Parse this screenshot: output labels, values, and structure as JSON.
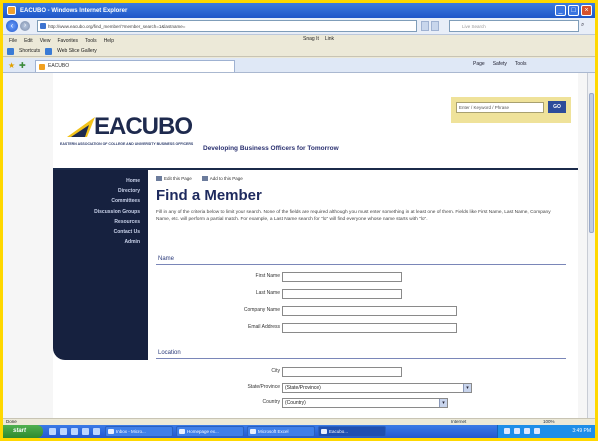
{
  "window": {
    "title": "EACUBO - Windows Internet Explorer",
    "controls": [
      "_",
      "□",
      "×"
    ]
  },
  "address": {
    "url": "http://www.eacubo.org/find_member/?member_search=1&lastname=",
    "search_placeholder": "Live Search"
  },
  "menubar": {
    "items": [
      "File",
      "Edit",
      "View",
      "Favorites",
      "Tools",
      "Help"
    ],
    "extras": [
      "Snag It",
      "Link"
    ]
  },
  "linksbar": {
    "items": [
      "Shortcuts",
      "Web Slice Gallery"
    ]
  },
  "tab": {
    "label": "EACUBO",
    "controls": [
      "Page",
      "Safety",
      "Tools"
    ]
  },
  "site": {
    "logo": "EACUBO",
    "logo_sub": "EASTERN ASSOCIATION OF COLLEGE AND UNIVERSITY BUSINESS OFFICERS",
    "tagline": "Developing Business Officers for Tomorrow",
    "quick_search": {
      "placeholder": "Enter / Keyword / Phrase",
      "go": "GO"
    }
  },
  "sidenav": {
    "items": [
      "Home",
      "Directory",
      "Committees",
      "Discussion Groups",
      "Resources",
      "Contact Us",
      "Admin"
    ]
  },
  "content": {
    "links": [
      "Edit this Page",
      "Add to this Page"
    ],
    "title": "Find a Member",
    "intro": "Fill in any of the criteria below to limit your search. None of the fields are required although you must enter something in at least one of them. Fields like First Name, Last Name, Company Name, etc. will perform a partial match. For example, a Last Name search for \"lo\" will find everyone whose name starts with \"lo\".",
    "sections": {
      "name": {
        "label": "Name",
        "fields": [
          "First Name",
          "Last Name",
          "Company Name",
          "Email Address"
        ]
      },
      "location": {
        "label": "Location",
        "city_label": "City",
        "state_label": "State/Province",
        "state_value": "(State/Province)",
        "country_label": "Country",
        "country_value": "(Country)"
      }
    }
  },
  "statusbar": {
    "text": "Done",
    "zone": "Internet",
    "zoom": "100%"
  },
  "taskbar": {
    "start": "start",
    "tasks": [
      "Inbox - Micro...",
      "Homepage ex...",
      "Microsoft Excel",
      "Eacubo..."
    ],
    "clock": "3:49 PM"
  }
}
